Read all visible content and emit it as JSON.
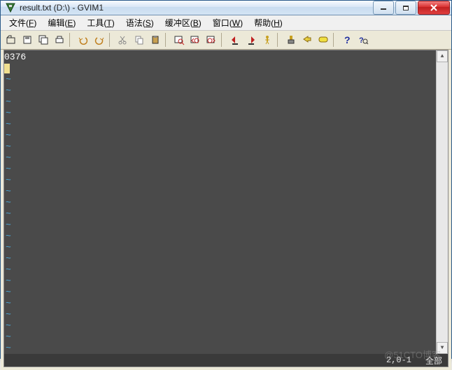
{
  "title": "result.txt (D:\\) - GVIM1",
  "menu": [
    {
      "label": "文件",
      "key": "F"
    },
    {
      "label": "编辑",
      "key": "E"
    },
    {
      "label": "工具",
      "key": "T"
    },
    {
      "label": "语法",
      "key": "S"
    },
    {
      "label": "缓冲区",
      "key": "B"
    },
    {
      "label": "窗口",
      "key": "W"
    },
    {
      "label": "帮助",
      "key": "H"
    }
  ],
  "toolbar_icons": [
    "open",
    "save",
    "save-all",
    "print",
    "undo",
    "redo",
    "cut",
    "copy",
    "paste",
    "find",
    "find-next",
    "find-prev",
    "shift-left",
    "shift-right",
    "jump",
    "make",
    "tag-push",
    "tag-pop",
    "help",
    "search-help"
  ],
  "editor": {
    "content_line1": "0376",
    "tilde_count": 25
  },
  "status": {
    "position": "2,0-1",
    "scope": "全部"
  },
  "watermark": "@51CTO博客"
}
